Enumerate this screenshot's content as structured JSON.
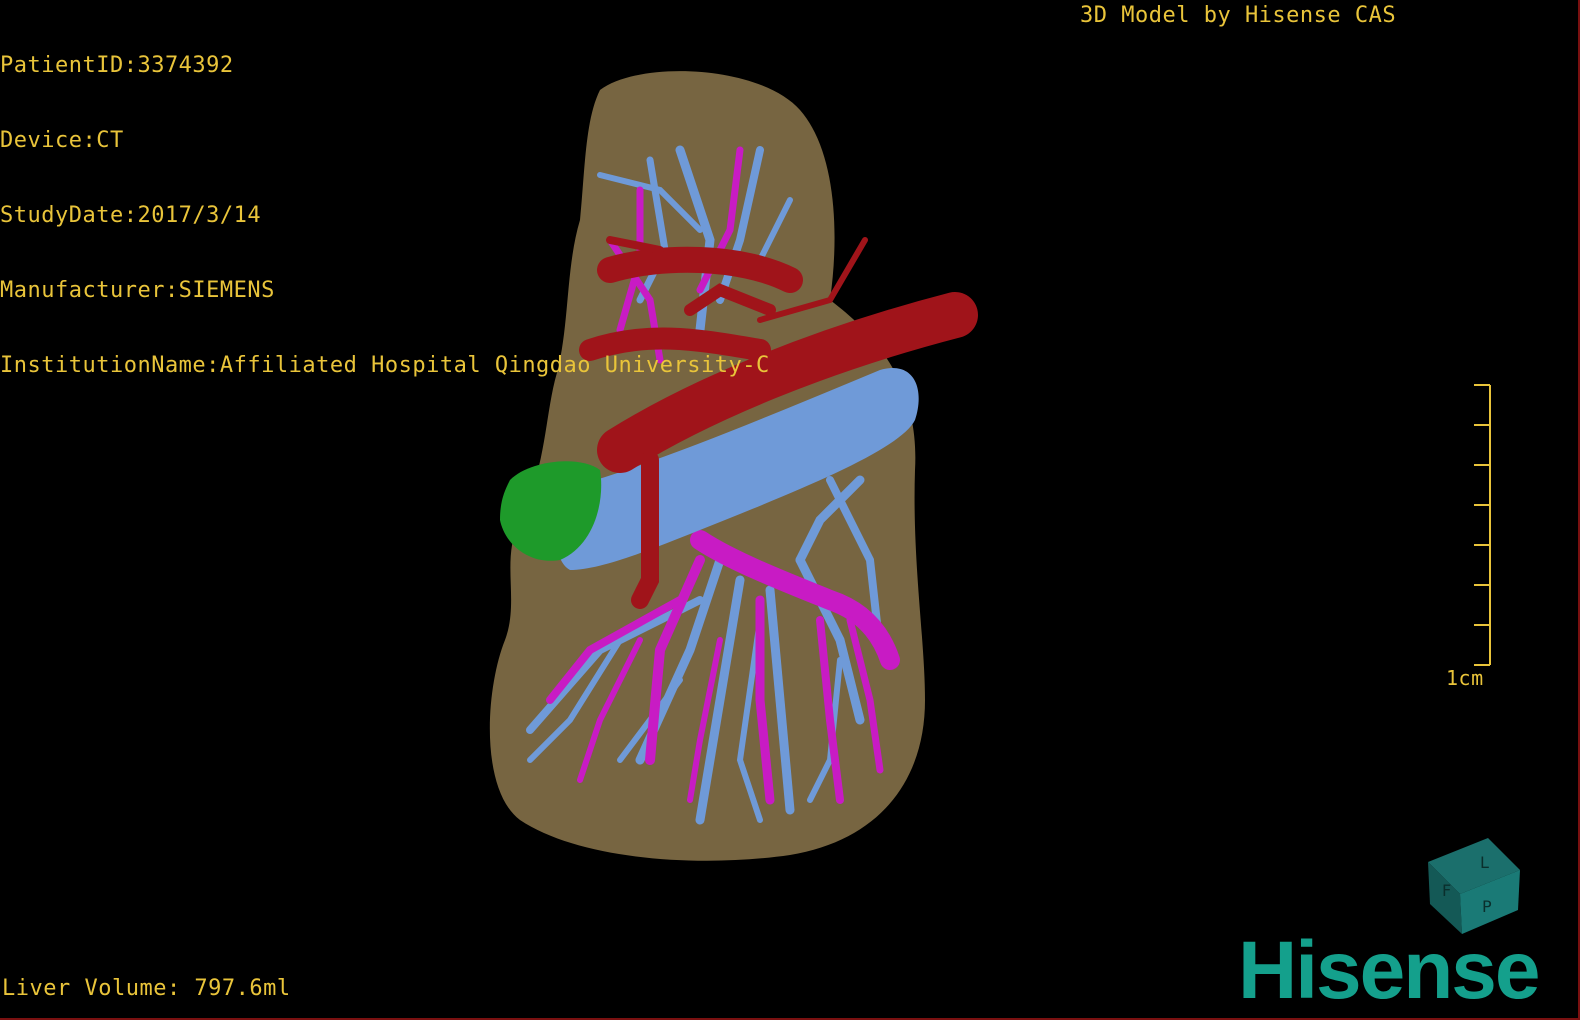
{
  "overlay": {
    "patient_id": "PatientID:3374392",
    "device": "Device:CT",
    "study_date": "StudyDate:2017/3/14",
    "manufacturer": "Manufacturer:SIEMENS",
    "institution": "InstitutionName:Affiliated Hospital Qingdao University-C",
    "credit": "3D Model by Hisense CAS",
    "liver_volume": "Liver Volume: 797.6ml",
    "scale_label": "1cm"
  },
  "orientation_cube": {
    "letters": [
      "F",
      "L",
      "P"
    ]
  },
  "brand": {
    "text": "Hisense",
    "color": "#14a08c"
  },
  "colors": {
    "text": "#e9c43a",
    "liver": "#7d6a45",
    "artery": "#a0141a",
    "portal_vein": "#6f9ad8",
    "hepatic_vein": "#c81bc4",
    "gallbladder": "#1e9a2a"
  }
}
